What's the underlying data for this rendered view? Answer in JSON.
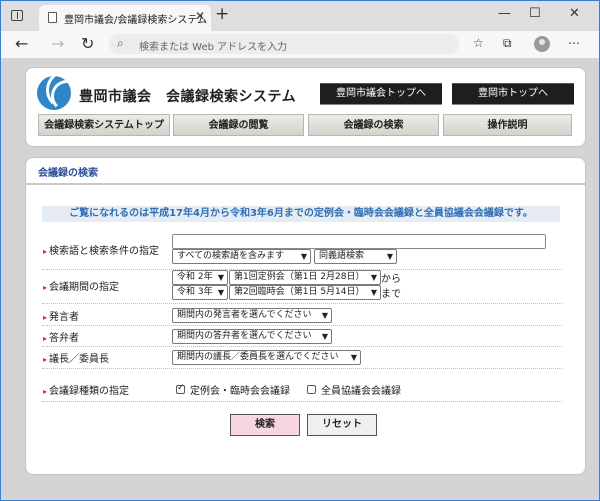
{
  "browser": {
    "tab_title": "豊岡市議会/会議録検索システム",
    "address_placeholder": "検索または Web アドレスを入力",
    "icons": [
      "tab-actions-icon",
      "page-icon",
      "close-icon",
      "new-tab-icon",
      "minimize-icon",
      "maximize-icon",
      "window-close-icon",
      "back-icon",
      "forward-icon",
      "refresh-icon",
      "search-icon",
      "favorites-icon",
      "collections-icon",
      "profile-icon",
      "more-icon"
    ]
  },
  "header": {
    "site_title": "豊岡市議会　会議録検索システム",
    "link_council_top": "豊岡市議会トップへ",
    "link_city_top": "豊岡市トップへ"
  },
  "menu": {
    "items": [
      "会議録検索システムトップ",
      "会議録の閲覧",
      "会議録の検索",
      "操作説明"
    ]
  },
  "search": {
    "title": "会議録の検索",
    "notice": "ご覧になれるのは平成17年4月から令和3年6月までの定例会・臨時会会議録と全員協議会会議録です。",
    "keyword": {
      "label": "検索語と検索条件の指定",
      "value": "",
      "condition": "すべての検索語を含みます",
      "mode": "同義語検索"
    },
    "period": {
      "label": "会議期間の指定",
      "from_year": "令和 2年",
      "from_session": "第1回定例会（第1日 2月28日）",
      "from_suffix": "から",
      "to_year": "令和 3年",
      "to_session": "第2回臨時会（第1日 5月14日）",
      "to_suffix": "まで"
    },
    "speaker": {
      "label": "発言者",
      "value": "期間内の発言者を選んでください"
    },
    "respondent": {
      "label": "答弁者",
      "value": "期間内の答弁者を選んでください"
    },
    "chair": {
      "label": "議長／委員長",
      "value": "期間内の議長／委員長を選んでください"
    },
    "kind": {
      "label": "会議録種類の指定",
      "options": [
        {
          "label": "定例会・臨時会会議録",
          "checked": true
        },
        {
          "label": "全員協議会会議録",
          "checked": false
        }
      ]
    },
    "buttons": {
      "search": "検索",
      "reset": "リセット"
    }
  },
  "colors": {
    "accent_blue": "#2f6fb5",
    "title_blue": "#2b4f9a",
    "search_button": "#f7d6e0",
    "header_button": "#1e1e1e"
  }
}
